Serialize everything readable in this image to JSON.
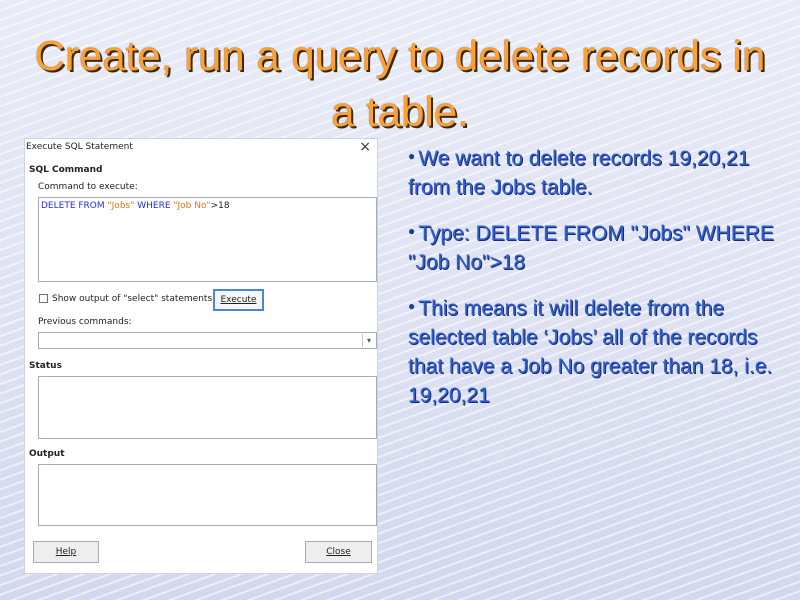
{
  "slide": {
    "title": "Create, run a query to delete records in a table.",
    "bullets": [
      "We want to delete records 19,20,21 from the Jobs table.",
      "Type: DELETE FROM \"Jobs\" WHERE \"Job No\">18",
      "This means it will delete from the selected table ‘Jobs’ all of the records that have a Job No greater than 18,  i.e. 19,20,21"
    ]
  },
  "dialog": {
    "title": "Execute SQL Statement",
    "sql_section": "SQL Command",
    "command_label": "Command to execute:",
    "command_parts": {
      "kw1": "DELETE FROM ",
      "table": "\"Jobs\"",
      "kw2": " WHERE ",
      "column": "\"Job No\"",
      "rest": ">18"
    },
    "show_output_label": "Show output of \"select\" statements",
    "show_output_checked": false,
    "execute_label": "Execute",
    "previous_label": "Previous commands:",
    "previous_value": "",
    "status_section": "Status",
    "status_text": "",
    "output_section": "Output",
    "output_text": "",
    "help_label": "Help",
    "close_label": "Close"
  },
  "colors": {
    "title": "#ffa033",
    "bullet_text": "#2f5fd6",
    "sql_keyword": "#2a2ae0",
    "sql_string": "#d9791a",
    "default_button_border": "#4a88d4"
  }
}
